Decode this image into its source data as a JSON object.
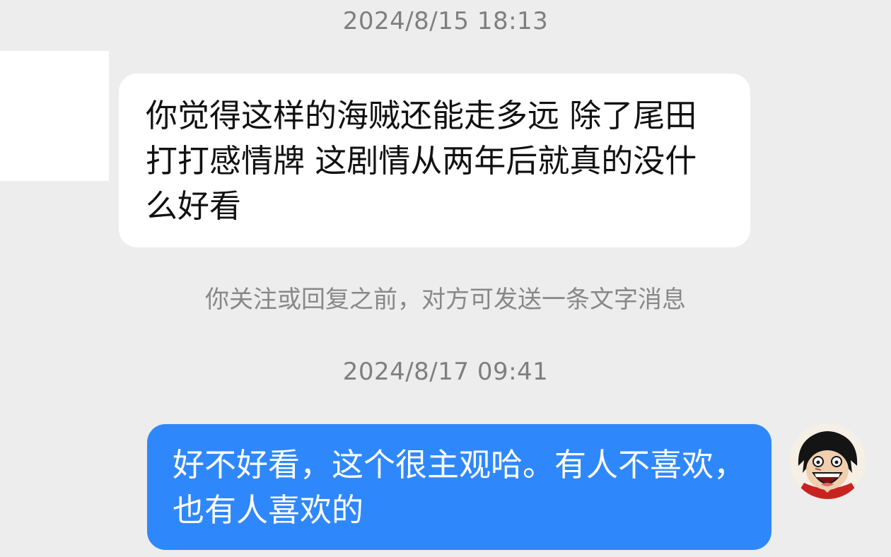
{
  "chat": {
    "timestamps": [
      "2024/8/15 18:13",
      "2024/8/17 09:41"
    ],
    "system_note": "你关注或回复之前，对方可发送一条文字消息",
    "messages": [
      {
        "side": "left",
        "text": "你觉得这样的海贼还能走多远 除了尾田打打感情牌 这剧情从两年后就真的没什么好看"
      },
      {
        "side": "right",
        "text": "好不好看，这个很主观哈。有人不喜欢，也有人喜欢的"
      }
    ]
  },
  "avatars": {
    "left": {
      "icon": "blank-avatar"
    },
    "right": {
      "icon": "luffy-avatar"
    }
  },
  "colors": {
    "background": "#ededed",
    "incoming_bubble": "#ffffff",
    "outgoing_bubble": "#2f88fb",
    "timestamp_text": "#7f7f7f"
  }
}
